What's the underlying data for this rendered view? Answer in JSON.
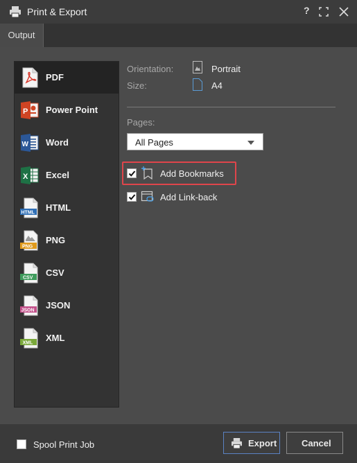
{
  "window": {
    "title": "Print & Export",
    "help_label": "?"
  },
  "tabs": [
    {
      "label": "Output"
    }
  ],
  "formats": [
    {
      "label": "PDF",
      "icon": "pdf-icon",
      "selected": true
    },
    {
      "label": "Power Point",
      "icon": "powerpoint-icon"
    },
    {
      "label": "Word",
      "icon": "word-icon"
    },
    {
      "label": "Excel",
      "icon": "excel-icon"
    },
    {
      "label": "HTML",
      "icon": "html-icon",
      "icon_text": "HTML"
    },
    {
      "label": "PNG",
      "icon": "png-icon",
      "icon_text": "PNG"
    },
    {
      "label": "CSV",
      "icon": "csv-icon",
      "icon_text": "CSV"
    },
    {
      "label": "JSON",
      "icon": "json-icon",
      "icon_text": "JSON"
    },
    {
      "label": "XML",
      "icon": "xml-icon",
      "icon_text": "XML"
    }
  ],
  "properties": {
    "orientation_label": "Orientation:",
    "orientation_value": "Portrait",
    "size_label": "Size:",
    "size_value": "A4"
  },
  "pages": {
    "label": "Pages:",
    "value": "All Pages"
  },
  "options": [
    {
      "label": "Add Bookmarks",
      "checked": true,
      "highlighted": true
    },
    {
      "label": "Add Link-back",
      "checked": true
    }
  ],
  "footer": {
    "spool_label": "Spool Print Job",
    "spool_checked": false,
    "export_label": "Export",
    "cancel_label": "Cancel"
  },
  "colors": {
    "accent_blue": "#5b83c4",
    "highlight_red": "#e0454b",
    "pdf_red": "#d9382b",
    "ppt_orange": "#d04423",
    "word_blue": "#2b5797",
    "excel_green": "#1e7145"
  }
}
